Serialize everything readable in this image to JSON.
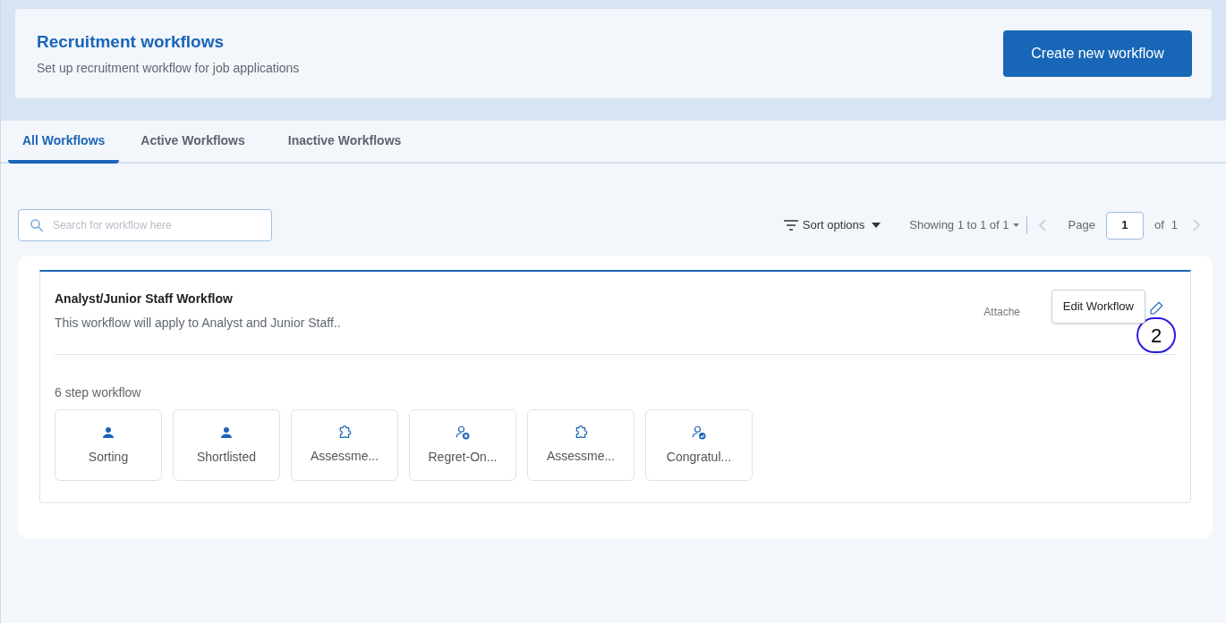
{
  "header": {
    "title": "Recruitment workflows",
    "subtitle": "Set up recruitment workflow for job applications",
    "create_button": "Create new workflow"
  },
  "tabs": [
    {
      "label": "All Workflows",
      "selected": true
    },
    {
      "label": "Active Workflows",
      "selected": false
    },
    {
      "label": "Inactive Workflows",
      "selected": false
    }
  ],
  "search": {
    "placeholder": "Search for workflow here"
  },
  "toolbar": {
    "sort": "Sort options",
    "showing": "Showing 1 to 1 of 1",
    "page_label": "Page",
    "page": "1",
    "of_label": "of",
    "total_pages": "1"
  },
  "workflow": {
    "title": "Analyst/Junior Staff Workflow",
    "description": "This workflow will apply to Analyst and Junior Staff..",
    "attached": "Attache",
    "tooltip": "Edit Workflow",
    "annotation": "2",
    "step_count": "6 step workflow",
    "steps": [
      {
        "kind": "person",
        "label": "Sorting"
      },
      {
        "kind": "person",
        "label": "Shortlisted"
      },
      {
        "kind": "puzzle",
        "label": "Assessme..."
      },
      {
        "kind": "person-x",
        "label": "Regret-On..."
      },
      {
        "kind": "puzzle",
        "label": "Assessme..."
      },
      {
        "kind": "person-check",
        "label": "Congratul..."
      }
    ]
  }
}
